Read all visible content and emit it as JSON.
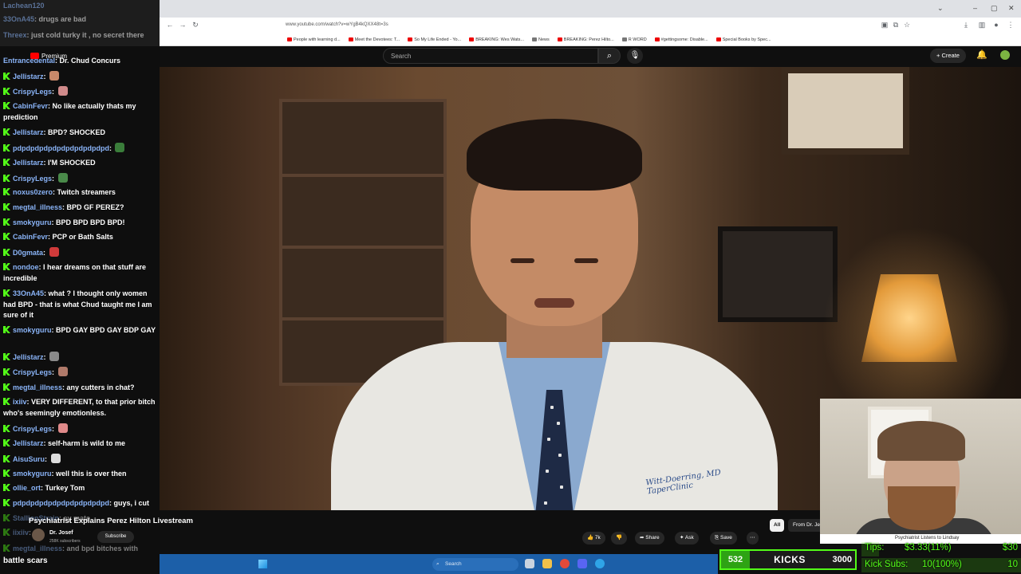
{
  "browser": {
    "url": "www.youtube.com/watch?v=wYgB4kQXX48t=3s",
    "bookmarks": [
      "People with learning d...",
      "Meet the Devotees: T...",
      "So My Life Ended - Yo...",
      "BREAKING: Wes Wats...",
      "News",
      "BREAKING: Perez Hilto...",
      "R WORD",
      "#gettingsome: Disable...",
      "Special Books by Spec..."
    ]
  },
  "masthead": {
    "search_placeholder": "Search",
    "create_label": "Create"
  },
  "chat": {
    "top_faded": [
      {
        "user": "Lachean120",
        "text": ""
      },
      {
        "user": "33OnA45",
        "text": "drugs are bad"
      },
      {
        "user": "Threex",
        "text": "just cold turky it , no secret there"
      },
      {
        "user": "Entrancedental",
        "text": "Dr. Chud Concurs"
      }
    ],
    "premium_label": "Premium",
    "messages": [
      {
        "user": "Jellistarz",
        "text": "",
        "emote": "#c8896a"
      },
      {
        "user": "CrispyLegs",
        "text": "",
        "emote": "#d08a8a"
      },
      {
        "user": "CabinFevr",
        "text": "No like actually thats my prediction"
      },
      {
        "user": "Jellistarz",
        "text": "BPD? SHOCKED"
      },
      {
        "user": "pdpdpdpdpdpdpdpdpdpdpd",
        "text": "",
        "emote": "#3a7d3a"
      },
      {
        "user": "Jellistarz",
        "text": "I'M SHOCKED"
      },
      {
        "user": "CrispyLegs",
        "text": "",
        "emote": "#4a8a4a"
      },
      {
        "user": "noxus0zero",
        "text": "Twitch streamers"
      },
      {
        "user": "megtal_illness",
        "text": "BPD GF PEREZ?"
      },
      {
        "user": "smokyguru",
        "text": "BPD BPD BPD BPD!"
      },
      {
        "user": "CabinFevr",
        "text": "PCP or Bath Salts"
      },
      {
        "user": "D0gmata",
        "text": "",
        "emote": "#d03a3a"
      },
      {
        "user": "nondoe",
        "text": "I hear dreams on that stuff are incredible"
      },
      {
        "user": "33OnA45",
        "text": "what ? I thought only women had BPD - that is what Chud taught me I am sure of it"
      },
      {
        "user": "smokyguru",
        "text": "BPD GAY BPD GAY BDP GAY"
      },
      {
        "user": "Jellistarz",
        "text": "",
        "emote": "#8a8a8a"
      },
      {
        "user": "CrispyLegs",
        "text": "",
        "emote": "#b07a6a"
      },
      {
        "user": "megtal_illness",
        "text": "any cutters in chat?"
      },
      {
        "user": "ixiiv",
        "text": "VERY DIFFERENT, to that prior bitch who's seemingly emotionless."
      },
      {
        "user": "CrispyLegs",
        "text": "",
        "emote": "#e08a8a"
      },
      {
        "user": "Jellistarz",
        "text": "self-harm is wild to me"
      },
      {
        "user": "AisuSuru",
        "text": "",
        "emote": "#dddddd"
      },
      {
        "user": "smokyguru",
        "text": "well this is over then"
      },
      {
        "user": "ollie_ort",
        "text": "Turkey Tom"
      },
      {
        "user": "pdpdpdpdpdpdpdpdpdpdpd",
        "text": "guys, i cut"
      },
      {
        "user": "StallionStrain",
        "text": "ey mate"
      },
      {
        "user": "iixiiv",
        "text": ""
      },
      {
        "user": "megtal_illness",
        "text": "and bpd bitches with"
      }
    ],
    "last_line": "battle scars"
  },
  "video": {
    "title": "Psychiatrist Explains Perez Hilton Livestream",
    "coat_embroidery": "Witt-Doerring, MD\nTaperClinic",
    "channel_name": "Dr. Josef",
    "channel_subs": "258K subscribers",
    "subscribe_label": "Subscribe",
    "like_count": "7k",
    "share_label": "Share",
    "ask_label": "Ask",
    "save_label": "Save",
    "chip_all": "All",
    "chip_from": "From Dr. Je"
  },
  "webcam_tab_text": "Psychiatrist Listens to Lindsay",
  "kicks": {
    "current": "532",
    "label": "KICKS",
    "goal": "3000"
  },
  "tips": {
    "tips_label": "Tips:",
    "tips_value": "$3.33(11%)",
    "tips_goal": "$30",
    "tips_fraction": 0.11,
    "subs_label": "Kick Subs:",
    "subs_value": "10(100%)",
    "subs_goal": "10",
    "subs_fraction": 1.0
  },
  "taskbar": {
    "search_label": "Search"
  },
  "colors": {
    "kick_green": "#53fc18",
    "yt_bg": "#0f0f0f",
    "taskbar": "#1c5fa8"
  }
}
